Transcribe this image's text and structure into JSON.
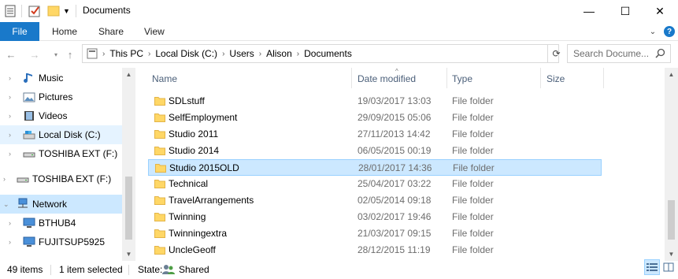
{
  "window": {
    "title": "Documents",
    "minimize_glyph": "—",
    "maximize_glyph": "☐",
    "close_glyph": "✕"
  },
  "ribbon": {
    "file": "File",
    "home": "Home",
    "share": "Share",
    "view": "View"
  },
  "address": {
    "crumbs": [
      "This PC",
      "Local Disk (C:)",
      "Users",
      "Alison",
      "Documents"
    ]
  },
  "search": {
    "placeholder": "Search Docume..."
  },
  "nav": {
    "items": [
      {
        "label": "Music",
        "icon": "music-icon"
      },
      {
        "label": "Pictures",
        "icon": "pictures-icon"
      },
      {
        "label": "Videos",
        "icon": "videos-icon"
      },
      {
        "label": "Local Disk (C:)",
        "icon": "drive-icon",
        "selected": true
      },
      {
        "label": "TOSHIBA EXT (F:)",
        "icon": "usb-drive-icon"
      },
      {
        "label": "TOSHIBA EXT (F:)",
        "icon": "usb-drive-icon"
      },
      {
        "label": "Network",
        "icon": "network-icon"
      },
      {
        "label": "BTHUB4",
        "icon": "computer-icon"
      },
      {
        "label": "FUJITSUP5925",
        "icon": "computer-icon"
      }
    ]
  },
  "columns": {
    "name": "Name",
    "date": "Date modified",
    "type": "Type",
    "size": "Size"
  },
  "files": [
    {
      "name": "SDLstuff",
      "date": "19/03/2017 13:03",
      "type": "File folder"
    },
    {
      "name": "SelfEmployment",
      "date": "29/09/2015 05:06",
      "type": "File folder"
    },
    {
      "name": "Studio 2011",
      "date": "27/11/2013 14:42",
      "type": "File folder"
    },
    {
      "name": "Studio 2014",
      "date": "06/05/2015 00:19",
      "type": "File folder"
    },
    {
      "name": "Studio 2015OLD",
      "date": "28/01/2017 14:36",
      "type": "File folder",
      "selected": true
    },
    {
      "name": "Technical",
      "date": "25/04/2017 03:22",
      "type": "File folder"
    },
    {
      "name": "TravelArrangements",
      "date": "02/05/2014 09:18",
      "type": "File folder"
    },
    {
      "name": "Twinning",
      "date": "03/02/2017 19:46",
      "type": "File folder"
    },
    {
      "name": "Twinningextra",
      "date": "21/03/2017 09:15",
      "type": "File folder"
    },
    {
      "name": "UncleGeoff",
      "date": "28/12/2015 11:19",
      "type": "File folder"
    }
  ],
  "status": {
    "items": "49 items",
    "selected": "1 item selected",
    "state_label": "State:",
    "state_value": "Shared"
  },
  "colors": {
    "accent": "#1979ca",
    "selection": "#cce8ff",
    "selection_border": "#99d1ff",
    "folder": "#ffd766"
  }
}
